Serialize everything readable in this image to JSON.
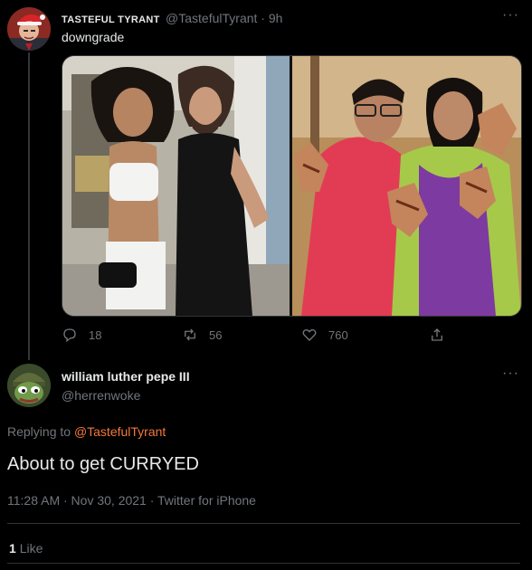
{
  "tweet1": {
    "display_name": "TASTEFUL TYRANT",
    "handle_time": "@TastefulTyrant · 9h",
    "text": "downgrade",
    "more": "···",
    "stats": {
      "replies": "18",
      "retweets": "56",
      "likes": "760"
    },
    "icons": [
      "reply-icon",
      "retweet-icon",
      "like-icon",
      "share-icon"
    ]
  },
  "tweet2": {
    "display_name": "william luther pepe III",
    "handle": "@herrenwoke",
    "more": "···",
    "replying_prefix": "Replying to ",
    "replying_to": "@TastefulTyrant",
    "text": "About to get CURRYED",
    "timestamp": "11:28 AM · Nov 30, 2021 · Twitter for iPhone",
    "likes_count": "1",
    "likes_label": "Like"
  },
  "colors": {
    "background": "#000000",
    "text": "#e7e9ea",
    "muted": "#71767b",
    "link": "#f4783c",
    "divider": "#2f3336"
  }
}
